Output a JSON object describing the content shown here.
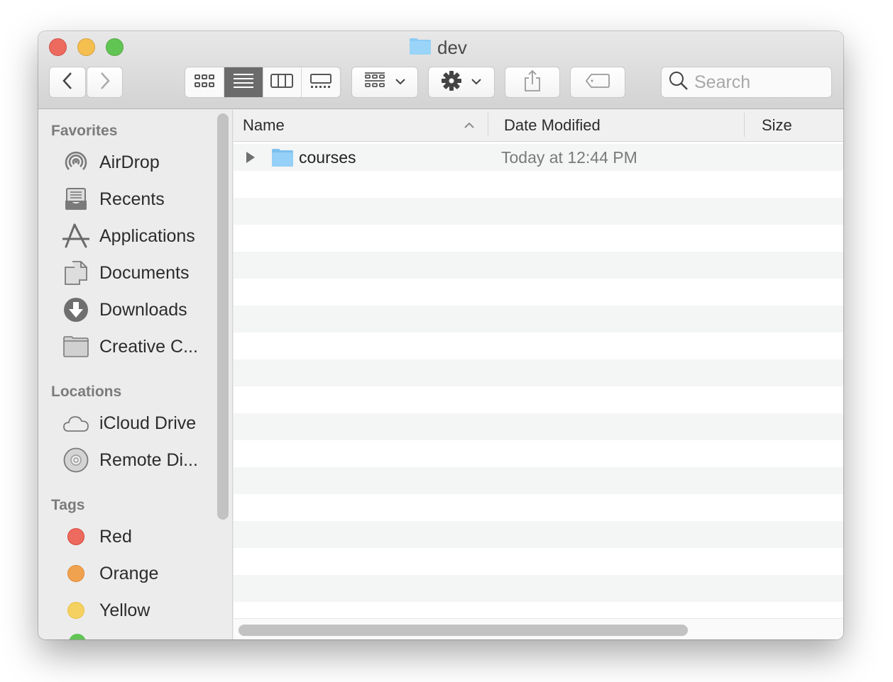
{
  "window": {
    "title": "dev",
    "title_icon": "folder-icon"
  },
  "toolbar": {
    "back": "chevron-left-icon",
    "forward": "chevron-right-icon",
    "view_modes": [
      {
        "name": "icon-view",
        "icon": "grid-icon",
        "active": false
      },
      {
        "name": "list-view",
        "icon": "list-icon",
        "active": true
      },
      {
        "name": "column-view",
        "icon": "columns-icon",
        "active": false
      },
      {
        "name": "gallery-view",
        "icon": "gallery-icon",
        "active": false
      }
    ],
    "group_button": "group-icon",
    "action_button": "gear-icon",
    "share_button": "share-icon",
    "tag_button": "tag-icon",
    "search_placeholder": "Search",
    "search_value": ""
  },
  "sidebar": {
    "favorites_heading": "Favorites",
    "favorites": [
      {
        "label": "AirDrop",
        "icon": "airdrop-icon"
      },
      {
        "label": "Recents",
        "icon": "recents-icon"
      },
      {
        "label": "Applications",
        "icon": "applications-icon"
      },
      {
        "label": "Documents",
        "icon": "documents-icon"
      },
      {
        "label": "Downloads",
        "icon": "downloads-icon"
      },
      {
        "label": "Creative C...",
        "icon": "folder-icon"
      }
    ],
    "locations_heading": "Locations",
    "locations": [
      {
        "label": "iCloud Drive",
        "icon": "cloud-icon"
      },
      {
        "label": "Remote Di...",
        "icon": "disc-icon"
      }
    ],
    "tags_heading": "Tags",
    "tags": [
      {
        "label": "Red",
        "color": "#ec6a5e"
      },
      {
        "label": "Orange",
        "color": "#f0a24e"
      },
      {
        "label": "Yellow",
        "color": "#f4d160"
      }
    ],
    "partial_tag_color": "#61c554"
  },
  "list": {
    "columns": {
      "name": "Name",
      "date": "Date Modified",
      "size": "Size"
    },
    "sort_indicator": "chevron-up-icon",
    "items": [
      {
        "name": "courses",
        "date_modified": "Today at 12:44 PM",
        "size": "",
        "kind": "folder"
      }
    ]
  },
  "colors": {
    "folder_blue": "#8ccbf5",
    "close": "#ed6a5e",
    "minimize": "#f5bf4f",
    "maximize": "#61c554"
  }
}
